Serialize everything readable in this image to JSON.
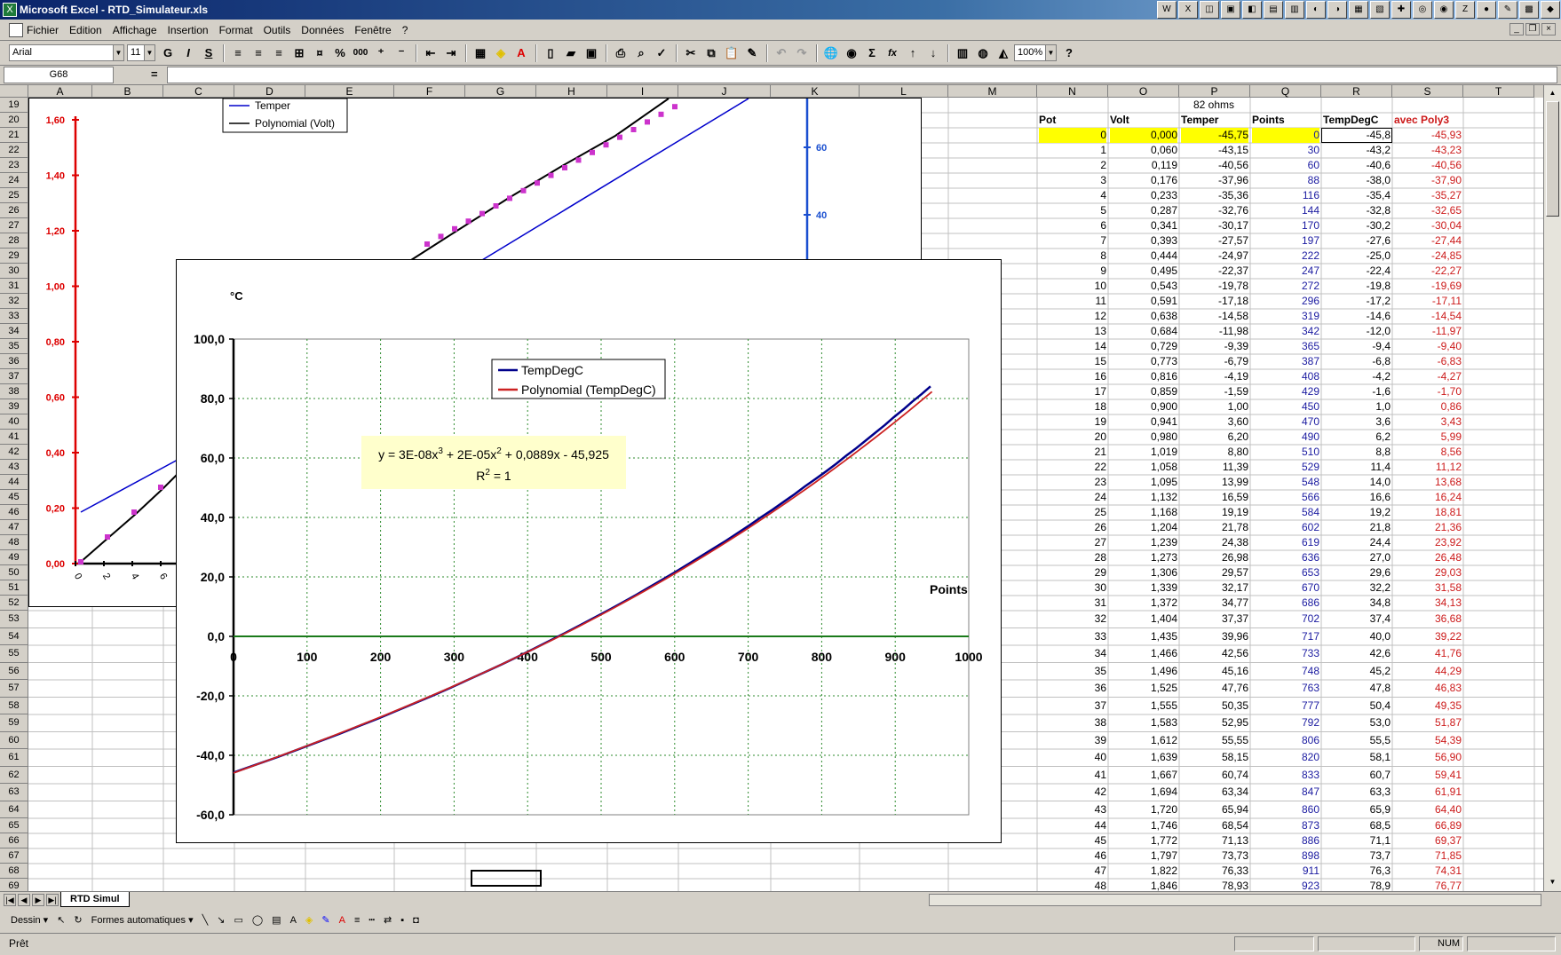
{
  "window": {
    "title": "Microsoft Excel - RTD_Simulateur.xls",
    "app_icon": "excel-icon"
  },
  "menu": [
    "Fichier",
    "Edition",
    "Affichage",
    "Insertion",
    "Format",
    "Outils",
    "Données",
    "Fenêtre",
    "?"
  ],
  "toolbar": {
    "font": "Arial",
    "size": "11",
    "zoom": "100%",
    "bold": "G",
    "italic": "I",
    "underline": "S",
    "sigma": "Σ",
    "fx": "fx",
    "percent": "%",
    "thousands": "000"
  },
  "formula_bar": {
    "cell_ref": "G68",
    "equals": "=",
    "content": ""
  },
  "columns": [
    "A",
    "B",
    "C",
    "D",
    "E",
    "F",
    "G",
    "H",
    "I",
    "J",
    "K",
    "L",
    "M",
    "N",
    "O",
    "P",
    "Q",
    "R",
    "S",
    "T"
  ],
  "rows_start": 19,
  "rows_end": 69,
  "table": {
    "info_value": "82 ohms",
    "headers": [
      "Pot",
      "Volt",
      "Temper",
      "Points",
      "TempDegC",
      "avec Poly3"
    ],
    "rows": [
      [
        "0",
        "0,000",
        "-45,75",
        "0",
        "-45,8",
        "-45,93"
      ],
      [
        "1",
        "0,060",
        "-43,15",
        "30",
        "-43,2",
        "-43,23"
      ],
      [
        "2",
        "0,119",
        "-40,56",
        "60",
        "-40,6",
        "-40,56"
      ],
      [
        "3",
        "0,176",
        "-37,96",
        "88",
        "-38,0",
        "-37,90"
      ],
      [
        "4",
        "0,233",
        "-35,36",
        "116",
        "-35,4",
        "-35,27"
      ],
      [
        "5",
        "0,287",
        "-32,76",
        "144",
        "-32,8",
        "-32,65"
      ],
      [
        "6",
        "0,341",
        "-30,17",
        "170",
        "-30,2",
        "-30,04"
      ],
      [
        "7",
        "0,393",
        "-27,57",
        "197",
        "-27,6",
        "-27,44"
      ],
      [
        "8",
        "0,444",
        "-24,97",
        "222",
        "-25,0",
        "-24,85"
      ],
      [
        "9",
        "0,495",
        "-22,37",
        "247",
        "-22,4",
        "-22,27"
      ],
      [
        "10",
        "0,543",
        "-19,78",
        "272",
        "-19,8",
        "-19,69"
      ],
      [
        "11",
        "0,591",
        "-17,18",
        "296",
        "-17,2",
        "-17,11"
      ],
      [
        "12",
        "0,638",
        "-14,58",
        "319",
        "-14,6",
        "-14,54"
      ],
      [
        "13",
        "0,684",
        "-11,98",
        "342",
        "-12,0",
        "-11,97"
      ],
      [
        "14",
        "0,729",
        "-9,39",
        "365",
        "-9,4",
        "-9,40"
      ],
      [
        "15",
        "0,773",
        "-6,79",
        "387",
        "-6,8",
        "-6,83"
      ],
      [
        "16",
        "0,816",
        "-4,19",
        "408",
        "-4,2",
        "-4,27"
      ],
      [
        "17",
        "0,859",
        "-1,59",
        "429",
        "-1,6",
        "-1,70"
      ],
      [
        "18",
        "0,900",
        "1,00",
        "450",
        "1,0",
        "0,86"
      ],
      [
        "19",
        "0,941",
        "3,60",
        "470",
        "3,6",
        "3,43"
      ],
      [
        "20",
        "0,980",
        "6,20",
        "490",
        "6,2",
        "5,99"
      ],
      [
        "21",
        "1,019",
        "8,80",
        "510",
        "8,8",
        "8,56"
      ],
      [
        "22",
        "1,058",
        "11,39",
        "529",
        "11,4",
        "11,12"
      ],
      [
        "23",
        "1,095",
        "13,99",
        "548",
        "14,0",
        "13,68"
      ],
      [
        "24",
        "1,132",
        "16,59",
        "566",
        "16,6",
        "16,24"
      ],
      [
        "25",
        "1,168",
        "19,19",
        "584",
        "19,2",
        "18,81"
      ],
      [
        "26",
        "1,204",
        "21,78",
        "602",
        "21,8",
        "21,36"
      ],
      [
        "27",
        "1,239",
        "24,38",
        "619",
        "24,4",
        "23,92"
      ],
      [
        "28",
        "1,273",
        "26,98",
        "636",
        "27,0",
        "26,48"
      ],
      [
        "29",
        "1,306",
        "29,57",
        "653",
        "29,6",
        "29,03"
      ],
      [
        "30",
        "1,339",
        "32,17",
        "670",
        "32,2",
        "31,58"
      ],
      [
        "31",
        "1,372",
        "34,77",
        "686",
        "34,8",
        "34,13"
      ],
      [
        "32",
        "1,404",
        "37,37",
        "702",
        "37,4",
        "36,68"
      ],
      [
        "33",
        "1,435",
        "39,96",
        "717",
        "40,0",
        "39,22"
      ],
      [
        "34",
        "1,466",
        "42,56",
        "733",
        "42,6",
        "41,76"
      ],
      [
        "35",
        "1,496",
        "45,16",
        "748",
        "45,2",
        "44,29"
      ],
      [
        "36",
        "1,525",
        "47,76",
        "763",
        "47,8",
        "46,83"
      ],
      [
        "37",
        "1,555",
        "50,35",
        "777",
        "50,4",
        "49,35"
      ],
      [
        "38",
        "1,583",
        "52,95",
        "792",
        "53,0",
        "51,87"
      ],
      [
        "39",
        "1,612",
        "55,55",
        "806",
        "55,5",
        "54,39"
      ],
      [
        "40",
        "1,639",
        "58,15",
        "820",
        "58,1",
        "56,90"
      ],
      [
        "41",
        "1,667",
        "60,74",
        "833",
        "60,7",
        "59,41"
      ],
      [
        "42",
        "1,694",
        "63,34",
        "847",
        "63,3",
        "61,91"
      ],
      [
        "43",
        "1,720",
        "65,94",
        "860",
        "65,9",
        "64,40"
      ],
      [
        "44",
        "1,746",
        "68,54",
        "873",
        "68,5",
        "66,89"
      ],
      [
        "45",
        "1,772",
        "71,13",
        "886",
        "71,1",
        "69,37"
      ],
      [
        "46",
        "1,797",
        "73,73",
        "898",
        "73,7",
        "71,85"
      ],
      [
        "47",
        "1,822",
        "76,33",
        "911",
        "76,3",
        "74,31"
      ],
      [
        "48",
        "1,846",
        "78,93",
        "923",
        "78,9",
        "76,77"
      ]
    ]
  },
  "sheet_tab": "RTD Simul",
  "drawbar": {
    "dessin": "Dessin ▾",
    "formes": "Formes automatiques ▾"
  },
  "status": {
    "ready": "Prêt",
    "num": "NUM"
  },
  "chart_data": [
    {
      "type": "line",
      "title": "",
      "legend": [
        "Temper",
        "Polynomial (Volt)"
      ],
      "legend_position": "top-left",
      "y_left_ticks": [
        "0,00",
        "0,20",
        "0,40",
        "0,60",
        "0,80",
        "1,00",
        "1,20",
        "1,40",
        "1,60"
      ],
      "y_right_ticks": [
        "40",
        "60"
      ],
      "x_ticks": [
        "0",
        "2",
        "4",
        "6"
      ],
      "colors": {
        "left_axis": "#dd0000",
        "right_axis": "#1a4fd0",
        "temper": "#0000cc",
        "poly": "#000000",
        "markers": "#cc33cc"
      }
    },
    {
      "type": "line",
      "ylabel": "°C",
      "xlabel": "Points",
      "xlim": [
        0,
        1000
      ],
      "ylim": [
        -60,
        100
      ],
      "x_ticks": [
        "0",
        "100",
        "200",
        "300",
        "400",
        "500",
        "600",
        "700",
        "800",
        "900",
        "1000"
      ],
      "y_ticks": [
        "100,0",
        "80,0",
        "60,0",
        "40,0",
        "20,0",
        "0,0",
        "-20,0",
        "-40,0",
        "-60,0"
      ],
      "series": [
        {
          "name": "TempDegC",
          "color": "#00008b",
          "x": [
            0,
            30,
            60,
            88,
            116,
            144,
            170,
            197,
            222,
            247,
            272,
            296,
            319,
            342,
            365,
            387,
            408,
            429,
            450,
            470,
            490,
            510,
            529,
            548,
            566,
            584,
            602,
            619,
            636,
            653,
            670,
            686,
            702,
            717,
            733,
            748,
            763,
            777,
            792,
            806,
            820,
            833,
            847,
            860,
            873,
            886,
            898,
            911,
            923,
            936,
            948
          ],
          "y": [
            -45.8,
            -43.2,
            -40.6,
            -38.0,
            -35.4,
            -32.8,
            -30.2,
            -27.6,
            -25.0,
            -22.4,
            -19.8,
            -17.2,
            -14.6,
            -12.0,
            -9.4,
            -6.8,
            -4.2,
            -1.6,
            1.0,
            3.6,
            6.2,
            8.8,
            11.4,
            14.0,
            16.6,
            19.2,
            21.8,
            24.4,
            27.0,
            29.6,
            32.2,
            34.8,
            37.4,
            40.0,
            42.6,
            45.2,
            47.8,
            50.4,
            53.0,
            55.5,
            58.1,
            60.7,
            63.3,
            65.9,
            68.5,
            71.1,
            73.7,
            76.3,
            78.9,
            81.5,
            84.1
          ]
        },
        {
          "name": "Polynomial (TempDegC)",
          "color": "#cc2222"
        }
      ],
      "trendline_label": {
        "equation": "y = 3E-08x",
        "e1": "3",
        "p2": " + 2E-05x",
        "e2": "2",
        "p3": " + 0,0889x - 45,925",
        "r2a": "R",
        "r2e": "2",
        "r2b": " = 1"
      },
      "grid": true,
      "legend_position": "top-center"
    }
  ]
}
